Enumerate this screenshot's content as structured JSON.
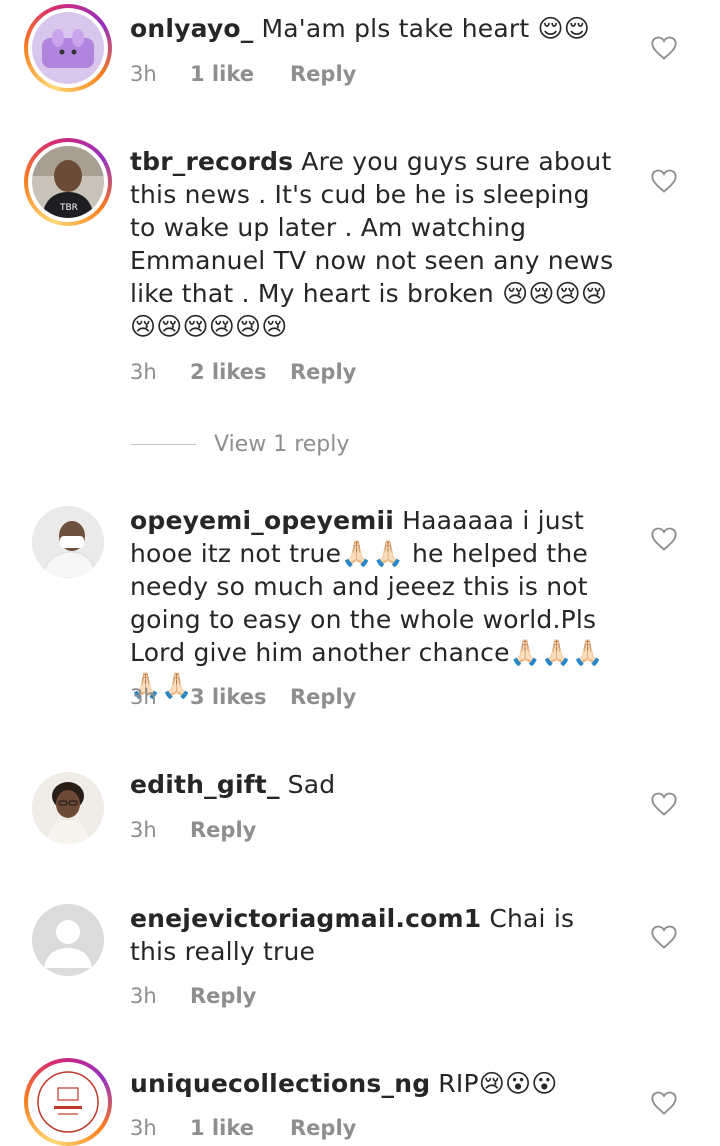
{
  "comments": [
    {
      "username": "onlyayo_",
      "text": "Ma'am pls take heart 😌😌",
      "time": "3h",
      "likes": "1 like",
      "reply": "Reply",
      "avatar_ring": true
    },
    {
      "username": "tbr_records",
      "text": "Are you guys sure about this news . It's cud be he is sleeping to wake up later . Am watching Emmanuel TV now not seen any news like that . My heart is broken 😢😢😢😢😢😢😢😢😢😢",
      "time": "3h",
      "likes": "2 likes",
      "reply": "Reply",
      "avatar_ring": true
    },
    {
      "username": "opeyemi_opeyemii",
      "text": "Haaaaaa i just hooe itz not true🙏🏻🙏🏻 he helped the needy so much and jeeez this is not going to easy on the whole world.Pls Lord give him another chance🙏🏻🙏🏻🙏🏻🙏🏻🙏🏻",
      "time": "3h",
      "likes": "3 likes",
      "reply": "Reply",
      "avatar_ring": false
    },
    {
      "username": "edith_gift_",
      "text": "Sad",
      "time": "3h",
      "likes": "",
      "reply": "Reply",
      "avatar_ring": false
    },
    {
      "username": "enejevictoriagmail.com1",
      "text": "Chai is this really true",
      "time": "3h",
      "likes": "",
      "reply": "Reply",
      "avatar_ring": false
    },
    {
      "username": "uniquecollections_ng",
      "text": "RIP😢😮😮",
      "time": "3h",
      "likes": "1 like",
      "reply": "Reply",
      "avatar_ring": true
    }
  ],
  "view_replies_label": "View 1 reply",
  "colors": {
    "text": "#262626",
    "meta": "#8e8e8e",
    "ring_gradient": [
      "#feda75",
      "#fa7e1e",
      "#d62976",
      "#962fbf"
    ]
  },
  "icons": {
    "like": "heart-outline-icon"
  }
}
